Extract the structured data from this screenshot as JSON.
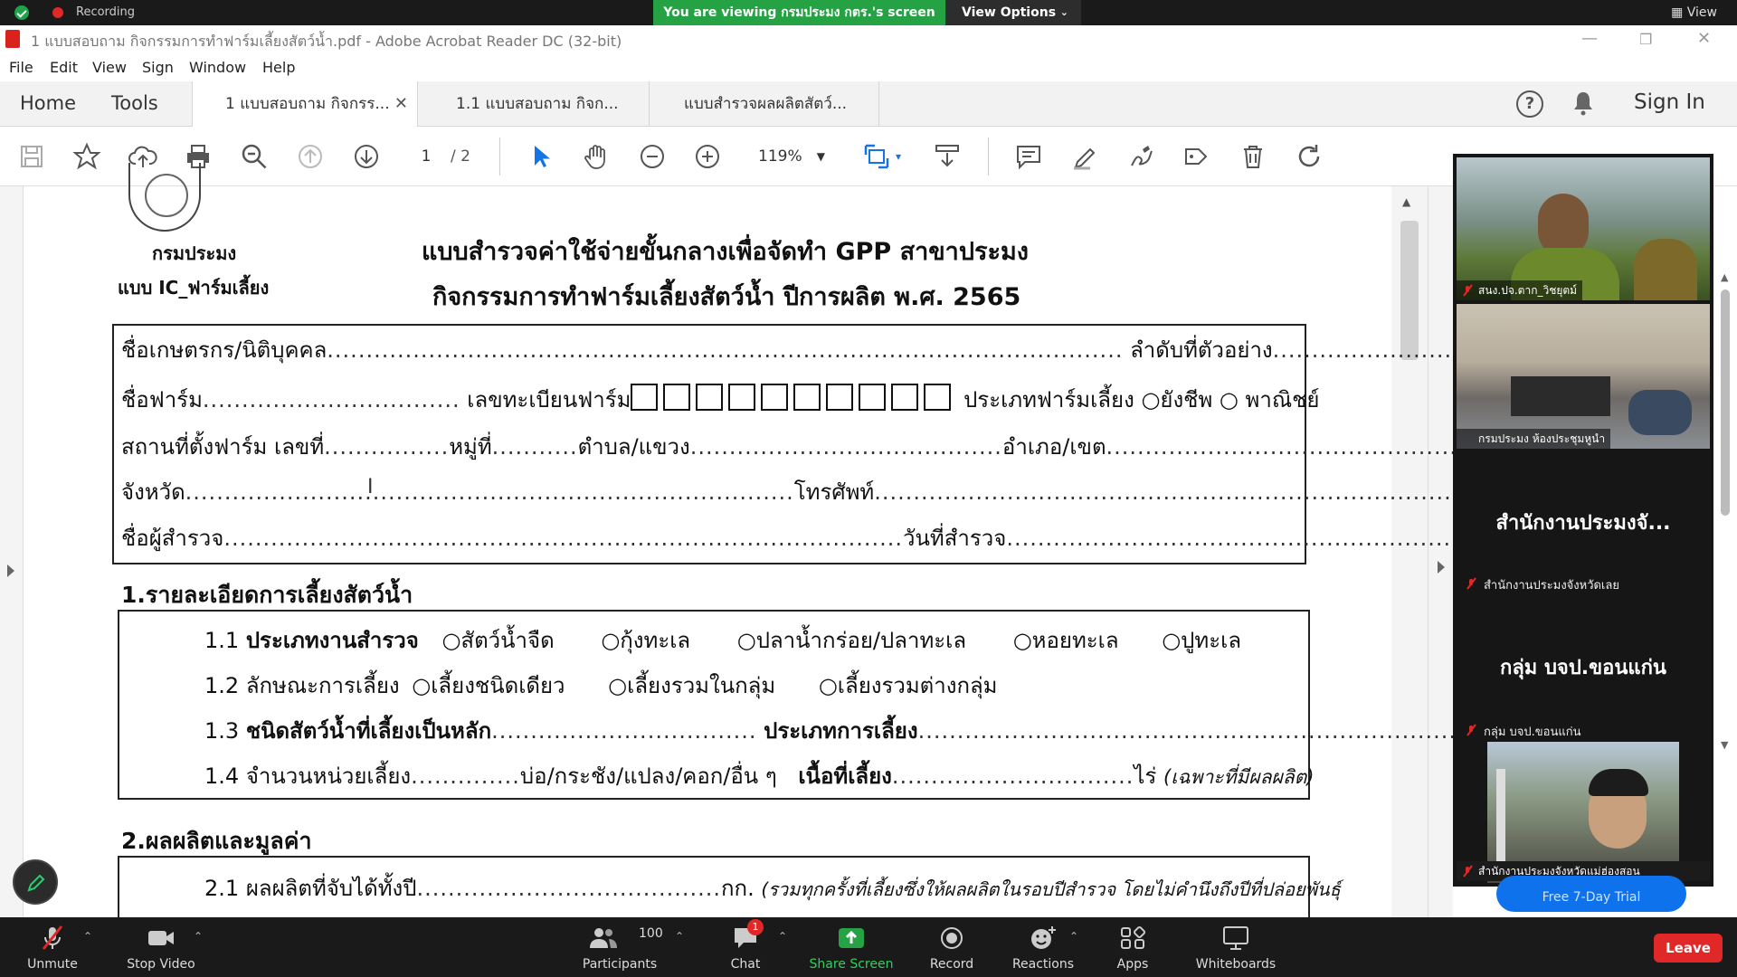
{
  "zoom": {
    "recording_label": "Recording",
    "share_banner": "You are viewing กรมประมง กตร.'s screen",
    "view_options": "View Options",
    "view_right": "View",
    "participants_count": "100",
    "chat_badge": "1",
    "bottom": {
      "unmute": "Unmute",
      "stop_video": "Stop Video",
      "participants": "Participants",
      "chat": "Chat",
      "share_screen": "Share Screen",
      "record": "Record",
      "reactions": "Reactions",
      "apps": "Apps",
      "whiteboards": "Whiteboards",
      "leave": "Leave"
    },
    "gallery": {
      "tile1_name": "สนง.ปจ.ตาก_วิชยุตม์",
      "tile2_name": "กรมประมง ห้องประชุมหูนำ",
      "tile3_big": "สำนักงานประมงจั...",
      "tile3_small": "สำนักงานประมงจังหวัดเลย",
      "tile4_big": "กลุ่ม บจป.ขอนแก่น",
      "tile4_small": "กลุ่ม บจป.ขอนแก่น",
      "tile5_name": "สำนักงานประมงจังหวัดแม่ฮ่องสอน",
      "trial_label": "Free 7-Day Trial"
    }
  },
  "acrobat": {
    "window_title": "1 แบบสอบถาม กิจกรรมการทำฟาร์มเลี้ยงสัตว์น้ำ.pdf - Adobe Acrobat Reader DC (32-bit)",
    "menu": [
      "File",
      "Edit",
      "View",
      "Sign",
      "Window",
      "Help"
    ],
    "nav": {
      "home": "Home",
      "tools": "Tools",
      "sign_in": "Sign In"
    },
    "tabs": [
      {
        "label": "1 แบบสอบถาม กิจกรร..."
      },
      {
        "label": "1.1 แบบสอบถาม กิจก..."
      },
      {
        "label": "แบบสำรวจผลผลิตสัตว์..."
      }
    ],
    "page_current": "1",
    "page_total": "/ 2",
    "zoom_level": "119%"
  },
  "document": {
    "dept": "กรมประมง",
    "form_code": "แบบ IC_ฟาร์มเลี้ยง",
    "title1": "แบบสำรวจค่าใช้จ่ายขั้นกลางเพื่อจัดทำ GPP สาขาประมง",
    "title2": "กิจกรรมการทำฟาร์มเลี้ยงสัตว์น้ำ ปีการผลิต พ.ศ. 2565",
    "box1": {
      "farmer": "ชื่อเกษตรกร/นิติบุคคล",
      "sample_no": "ลำดับที่ตัวอย่าง",
      "farm_name": "ชื่อฟาร์ม",
      "farm_reg": "เลขทะเบียนฟาร์ม",
      "farm_type": "ประเภทฟาร์มเลี้ยง",
      "opt_subsist": "ยังชีพ",
      "opt_commercial": "พาณิชย์",
      "location": "สถานที่ตั้งฟาร์ม เลขที่",
      "moo": "หมู่ที่",
      "tambon": "ตำบล/แขวง",
      "amphoe": "อำเภอ/เขต",
      "province": "จังหวัด",
      "phone": "โทรศัพท์",
      "surveyor": "ชื่อผู้สำรวจ",
      "survey_date": "วันที่สำรวจ"
    },
    "sec1": "1.รายละเอียดการเลี้ยงสัตว์น้ำ",
    "row11": {
      "num": "1.1",
      "label": "ประเภทงานสำรวจ",
      "opts": [
        "สัตว์น้ำจืด",
        "กุ้งทะเล",
        "ปลาน้ำกร่อย/ปลาทะเล",
        "หอยทะเล",
        "ปูทะเล"
      ]
    },
    "row12": {
      "num": "1.2",
      "label": "ลักษณะการเลี้ยง",
      "opts": [
        "เลี้ยงชนิดเดียว",
        "เลี้ยงรวมในกลุ่ม",
        "เลี้ยงรวมต่างกลุ่ม"
      ]
    },
    "row13": {
      "num": "1.3",
      "label": "ชนิดสัตว์น้ำที่เลี้ยงเป็นหลัก",
      "label2": "ประเภทการเลี้ยง"
    },
    "row14": {
      "num": "1.4",
      "label": "จำนวนหน่วยเลี้ยง",
      "units": "บ่อ/กระชัง/แปลง/คอก/อื่น ๆ",
      "area": "เนื้อที่เลี้ยง",
      "rai": "ไร่",
      "note": "(เฉพาะที่มีผลผลิต)"
    },
    "sec2": "2.ผลผลิตและมูลค่า",
    "row21": {
      "num": "2.1",
      "label": "ผลผลิตที่จับได้ทั้งปี",
      "unit": "กก.",
      "note": "(รวมทุกครั้งที่เลี้ยงซึ่งให้ผลผลิตในรอบปีสำรวจ โดยไม่คำนึงถึงปีที่ปล่อยพันธุ์"
    }
  },
  "colors": {
    "accent_green": "#25a244",
    "leave_red": "#e02828",
    "acrobat_red": "#d9221c",
    "select_blue": "#1473e6"
  }
}
